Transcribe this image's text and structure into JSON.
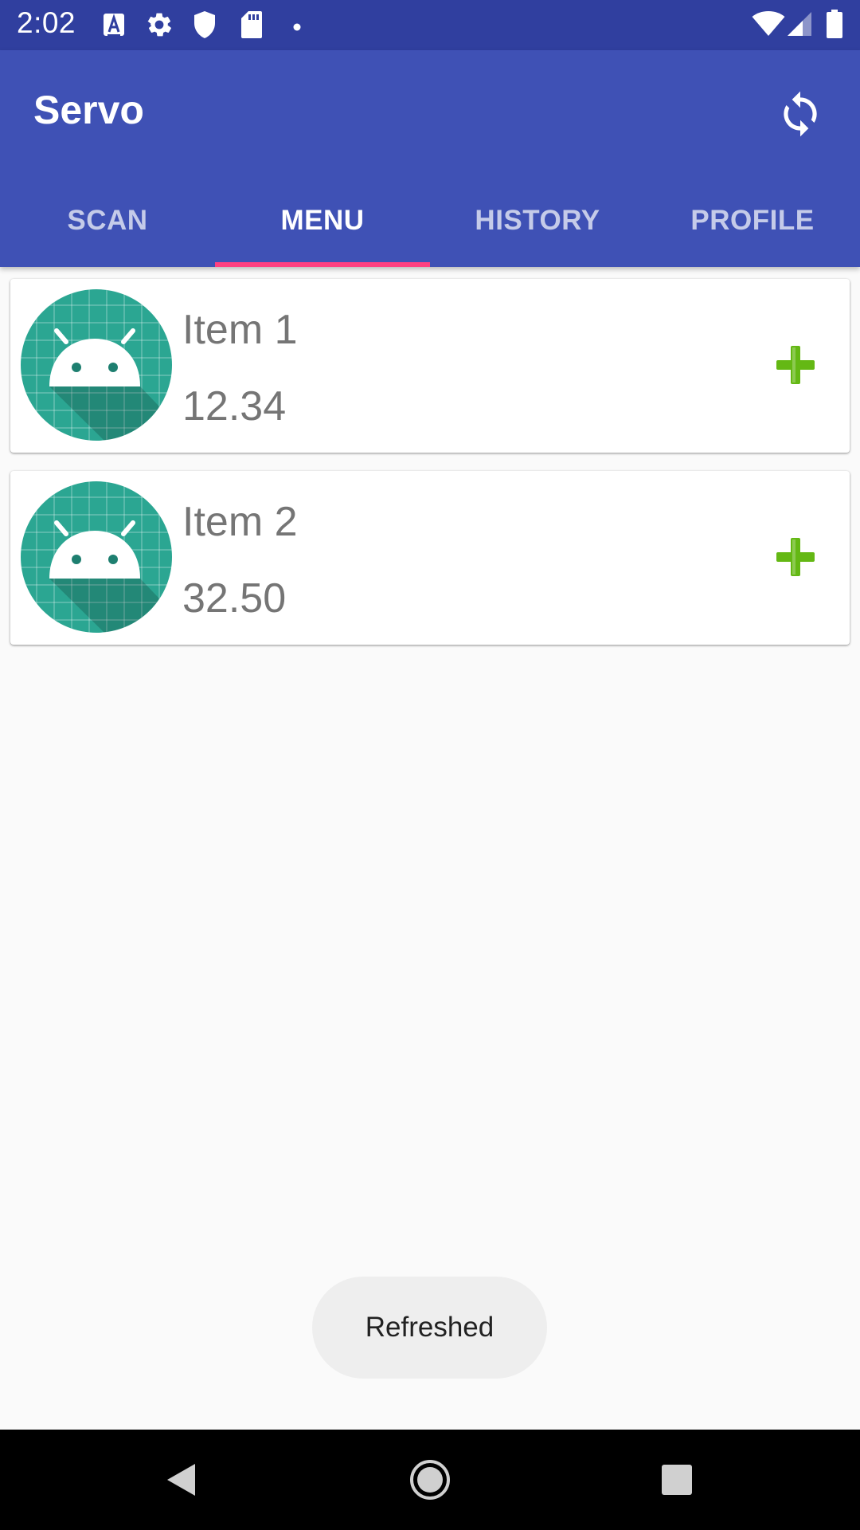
{
  "status_bar": {
    "time": "2:02",
    "icons": [
      "font-icon",
      "gear-icon",
      "shield-icon",
      "sd-card-icon",
      "dot-icon",
      "wifi-icon",
      "signal-icon",
      "battery-icon"
    ],
    "background": "#303f9f"
  },
  "app_bar": {
    "title": "Servo",
    "background": "#3f51b5",
    "refresh_icon": "sync-icon"
  },
  "tabs": [
    {
      "label": "SCAN",
      "active": false
    },
    {
      "label": "MENU",
      "active": true
    },
    {
      "label": "HISTORY",
      "active": false
    },
    {
      "label": "PROFILE",
      "active": false
    }
  ],
  "tab_indicator_color": "#ff4081",
  "items": [
    {
      "name": "Item 1",
      "price": "12.34",
      "icon": "android-icon",
      "action_icon": "plus-icon"
    },
    {
      "name": "Item 2",
      "price": "32.50",
      "icon": "android-icon",
      "action_icon": "plus-icon"
    }
  ],
  "toast": {
    "message": "Refreshed"
  },
  "nav_bar": {
    "icons": [
      "back-icon",
      "home-icon",
      "recents-icon"
    ]
  },
  "colors": {
    "plus_green": "#64b814",
    "avatar_teal": "#2ba692"
  }
}
